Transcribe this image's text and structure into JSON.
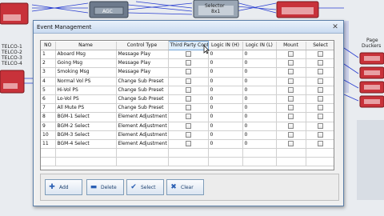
{
  "background": {
    "telco_labels": [
      "TELCO-1",
      "TELCO-2",
      "TELCO-3",
      "TELCO-4"
    ],
    "top_block_text": [
      "AGC",
      "Selector",
      "8x1"
    ],
    "right_label": [
      "Page",
      "Duckers"
    ]
  },
  "dialog": {
    "title": "Event Management",
    "columns": [
      "NO",
      "Name",
      "Control Type",
      "Third Party Contr",
      "Logic IN (H)",
      "Logic IN (L)",
      "Mount",
      "Select"
    ],
    "rows": [
      {
        "no": "1",
        "name": "Aboard Msg",
        "type": "Message Play",
        "lh": "0",
        "ll": "0"
      },
      {
        "no": "2",
        "name": "Going Msg",
        "type": "Message Play",
        "lh": "0",
        "ll": "0"
      },
      {
        "no": "3",
        "name": "Smoking Msg",
        "type": "Message Play",
        "lh": "0",
        "ll": "0"
      },
      {
        "no": "4",
        "name": "Normal Vol PS",
        "type": "Change Sub Preset",
        "lh": "0",
        "ll": "0"
      },
      {
        "no": "5",
        "name": "Hi-Vol PS",
        "type": "Change Sub Preset",
        "lh": "0",
        "ll": "0"
      },
      {
        "no": "6",
        "name": "Lo-Vol PS",
        "type": "Change Sub Preset",
        "lh": "0",
        "ll": "0"
      },
      {
        "no": "7",
        "name": "All Mute PS",
        "type": "Change Sub Preset",
        "lh": "0",
        "ll": "0"
      },
      {
        "no": "8",
        "name": "BGM-1 Select",
        "type": "Element Adjustment",
        "lh": "0",
        "ll": "0"
      },
      {
        "no": "9",
        "name": "BGM-2 Select",
        "type": "Element Adjustment",
        "lh": "0",
        "ll": "0"
      },
      {
        "no": "10",
        "name": "BGM-3 Select",
        "type": "Element Adjustment",
        "lh": "0",
        "ll": "0"
      },
      {
        "no": "11",
        "name": "BGM-4 Select",
        "type": "Element Adjustment",
        "lh": "0",
        "ll": "0"
      }
    ],
    "buttons": {
      "add": "Add",
      "delete": "Delete",
      "select": "Select",
      "clear": "Clear"
    }
  },
  "colors": {
    "block_red": "#c8323a",
    "block_grey": "#9aa6b4",
    "link_blue": "#2a3fd0",
    "accent": "#1c3f6e"
  }
}
